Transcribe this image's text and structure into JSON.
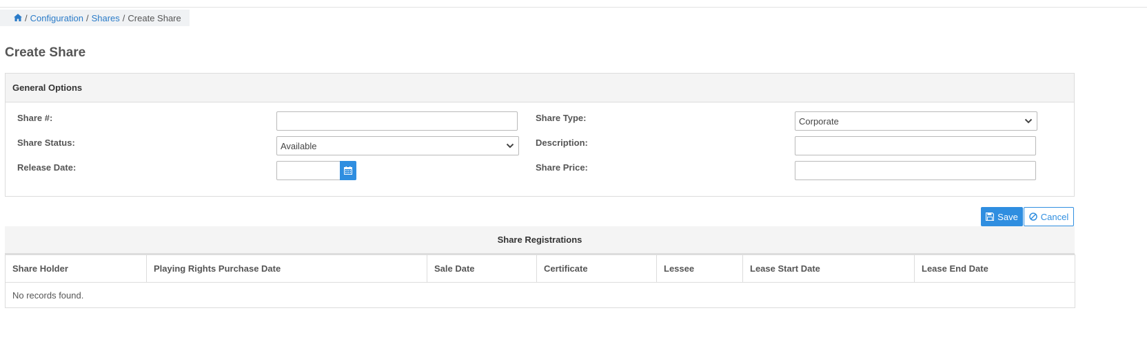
{
  "breadcrumb": {
    "home_icon": "home-icon",
    "items": [
      "Configuration",
      "Shares",
      "Create Share"
    ],
    "separator": "/"
  },
  "page": {
    "title": "Create Share"
  },
  "general_options": {
    "title": "General Options",
    "share_number": {
      "label": "Share #:",
      "value": ""
    },
    "share_status": {
      "label": "Share Status:",
      "value": "Available"
    },
    "release_date": {
      "label": "Release Date:",
      "value": ""
    },
    "share_type": {
      "label": "Share Type:",
      "value": "Corporate"
    },
    "description": {
      "label": "Description:",
      "value": ""
    },
    "share_price": {
      "label": "Share Price:",
      "value": ""
    }
  },
  "actions": {
    "save": "Save",
    "cancel": "Cancel"
  },
  "registrations": {
    "title": "Share Registrations",
    "columns": [
      "Share Holder",
      "Playing Rights Purchase Date",
      "Sale Date",
      "Certificate",
      "Lessee",
      "Lease Start Date",
      "Lease End Date"
    ],
    "empty_message": "No records found."
  },
  "colors": {
    "accent": "#2f8ee0",
    "link": "#2a7bc8"
  }
}
